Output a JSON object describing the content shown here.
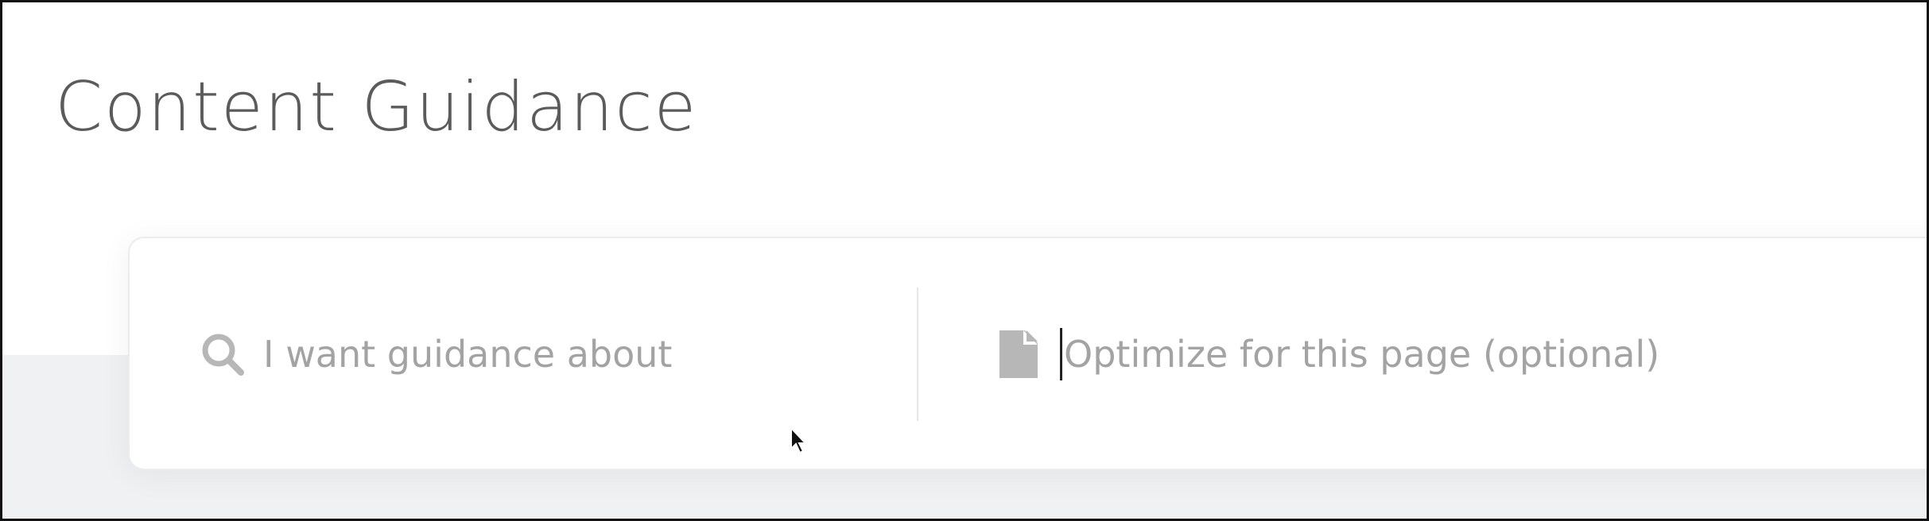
{
  "page": {
    "title": "Content Guidance"
  },
  "search": {
    "topic_placeholder": "I want guidance about",
    "topic_value": "",
    "topic_icon": "search-icon",
    "page_placeholder": "Optimize for this page (optional)",
    "page_value": "",
    "page_icon": "document-icon"
  },
  "colors": {
    "title": "#5b5b5b",
    "placeholder": "#a3a3a3",
    "icon": "#b7b7b7",
    "band": "#eff1f2"
  }
}
